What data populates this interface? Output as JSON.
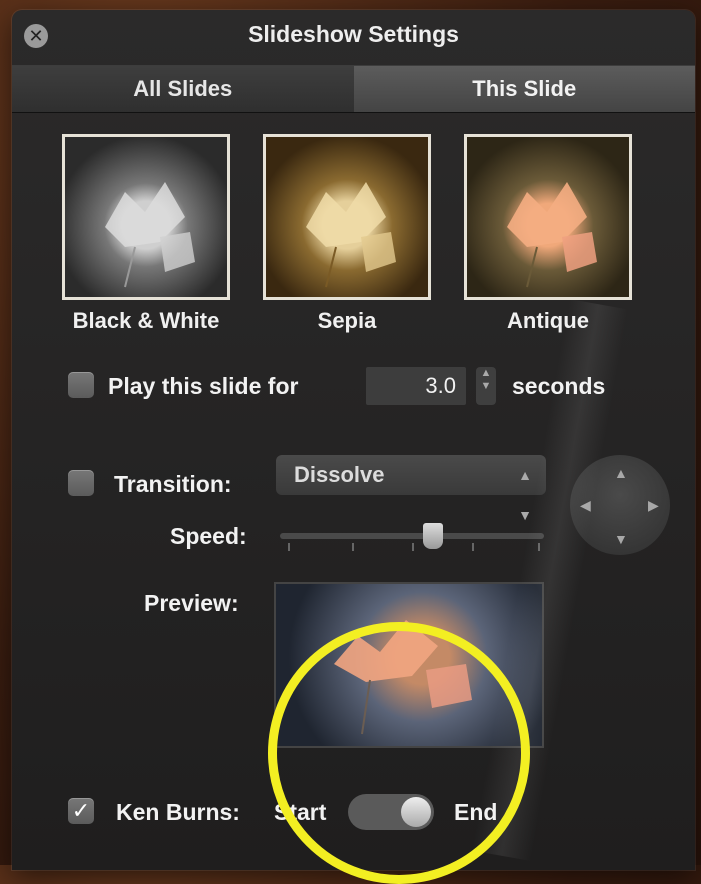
{
  "window": {
    "title": "Slideshow Settings"
  },
  "tabs": [
    {
      "label": "All Slides",
      "active": false
    },
    {
      "label": "This Slide",
      "active": true
    }
  ],
  "effects": [
    {
      "label": "Black & White"
    },
    {
      "label": "Sepia"
    },
    {
      "label": "Antique"
    }
  ],
  "play": {
    "label": "Play this slide for",
    "value": "3.0",
    "unit": "seconds",
    "checked": false
  },
  "transition": {
    "label": "Transition:",
    "value": "Dissolve",
    "checked": false
  },
  "speed": {
    "label": "Speed:",
    "level": 0.58
  },
  "preview": {
    "label": "Preview:"
  },
  "ken_burns": {
    "label": "Ken Burns:",
    "checked": true,
    "start_label": "Start",
    "end_label": "End"
  },
  "icons": {
    "close": "close-icon",
    "check": "checkmark-icon",
    "stepper": "stepper-icon",
    "select_arrows": "updown-chevron-icon",
    "dpad": "direction-pad-icon"
  },
  "colors": {
    "panel": "#232222",
    "annotation": "#f3ef22"
  }
}
